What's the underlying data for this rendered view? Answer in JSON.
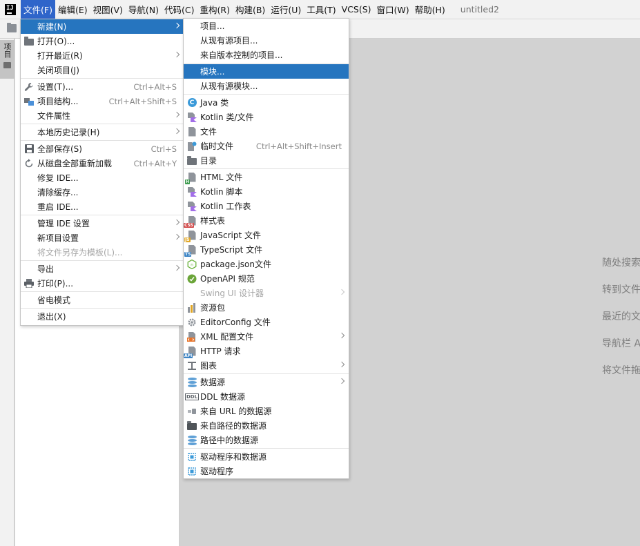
{
  "menubar": {
    "logo": "IJ",
    "items": [
      "文件(F)",
      "编辑(E)",
      "视图(V)",
      "导航(N)",
      "代码(C)",
      "重构(R)",
      "构建(B)",
      "运行(U)",
      "工具(T)",
      "VCS(S)",
      "窗口(W)",
      "帮助(H)"
    ],
    "project_title": "untitled2"
  },
  "sidebar": {
    "project_tab": "项目"
  },
  "welcome_hints": [
    "随处搜索",
    "转到文件",
    "最近的文件",
    "导航栏 A",
    "将文件拖"
  ],
  "file_menu": {
    "new": "新建(N)",
    "open": "打开(O)...",
    "open_recent": "打开最近(R)",
    "close_project": "关闭项目(J)",
    "settings": "设置(T)...",
    "settings_sc": "Ctrl+Alt+S",
    "project_structure": "项目结构...",
    "project_structure_sc": "Ctrl+Alt+Shift+S",
    "file_properties": "文件属性",
    "local_history": "本地历史记录(H)",
    "save_all": "全部保存(S)",
    "save_all_sc": "Ctrl+S",
    "reload_all": "从磁盘全部重新加载",
    "reload_all_sc": "Ctrl+Alt+Y",
    "repair_ide": "修复 IDE...",
    "invalidate_caches": "清除缓存...",
    "restart_ide": "重启 IDE...",
    "manage_ide_settings": "管理 IDE 设置",
    "new_project_settings": "新项目设置",
    "save_as_template": "将文件另存为模板(L)...",
    "export": "导出",
    "print": "打印(P)...",
    "power_save": "省电模式",
    "exit": "退出(X)"
  },
  "new_menu": {
    "project": "项目...",
    "project_from_existing": "从现有源项目...",
    "project_from_vcs": "来自版本控制的项目...",
    "module": "模块...",
    "module_from_existing": "从现有源模块...",
    "java_class": "Java 类",
    "kotlin_class": "Kotlin 类/文件",
    "file": "文件",
    "scratch_file": "临时文件",
    "scratch_file_sc": "Ctrl+Alt+Shift+Insert",
    "directory": "目录",
    "html_file": "HTML 文件",
    "kotlin_script": "Kotlin 脚本",
    "kotlin_worksheet": "Kotlin 工作表",
    "stylesheet": "样式表",
    "javascript_file": "JavaScript 文件",
    "typescript_file": "TypeScript 文件",
    "package_json": "package.json文件",
    "openapi": "OpenAPI 规范",
    "swing_ui": "Swing UI 设计器",
    "resource_bundle": "资源包",
    "editorconfig": "EditorConfig 文件",
    "xml_config": "XML 配置文件",
    "http_request": "HTTP 请求",
    "diagram": "图表",
    "data_source": "数据源",
    "ddl_data_source": "DDL 数据源",
    "data_source_from_url": "来自 URL 的数据源",
    "data_source_from_path": "来自路径的数据源",
    "data_source_in_path": "路径中的数据源",
    "driver_and_data_source": "驱动程序和数据源",
    "driver": "驱动程序"
  },
  "icon_badges": {
    "html": "H",
    "css": "CSS",
    "js": "JS",
    "ts": "TS",
    "api": "API",
    "ddl": "DDL",
    "java": "C"
  },
  "colors": {
    "selection": "#2675bf",
    "menubar_active": "#2f65ca",
    "editor_bg": "#d2d2d2"
  }
}
